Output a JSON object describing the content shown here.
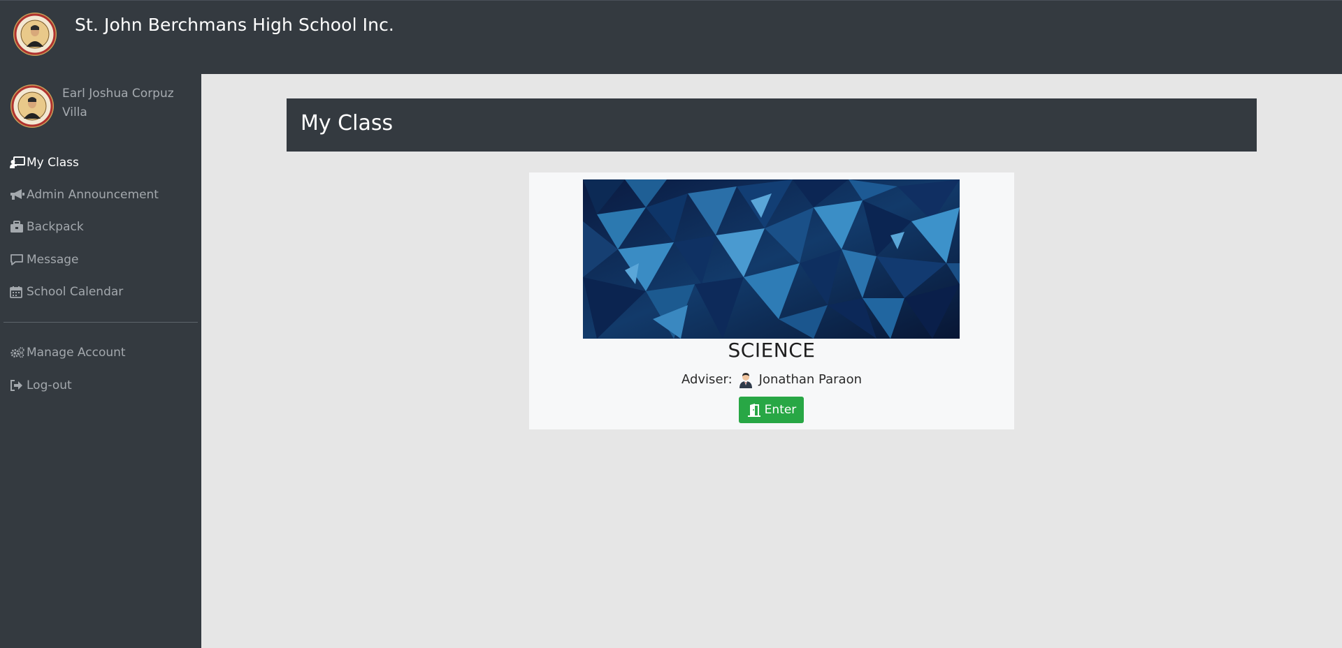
{
  "header": {
    "school_name": "St. John Berchmans High School Inc.",
    "logo_icon": "school-seal-icon"
  },
  "sidebar": {
    "user_name": "Earl Joshua Corpuz Villa",
    "nav": [
      {
        "label": "My Class",
        "icon": "chalkboard-teacher-icon",
        "active": true
      },
      {
        "label": "Admin Announcement",
        "icon": "bullhorn-icon",
        "active": false
      },
      {
        "label": "Backpack",
        "icon": "briefcase-icon",
        "active": false
      },
      {
        "label": "Message",
        "icon": "comment-icon",
        "active": false
      },
      {
        "label": "School Calendar",
        "icon": "calendar-icon",
        "active": false
      }
    ],
    "account_nav": [
      {
        "label": "Manage Account",
        "icon": "cogs-icon"
      },
      {
        "label": "Log-out",
        "icon": "sign-out-icon"
      }
    ]
  },
  "main": {
    "title": "My Class",
    "class_card": {
      "subject": "SCIENCE",
      "adviser_label": "Adviser:",
      "adviser_name": "Jonathan Paraon",
      "enter_label": "Enter"
    }
  },
  "colors": {
    "dark": "#343a40",
    "content_bg": "#e6e6e6",
    "card_bg": "#f7f8f9",
    "success": "#28a745",
    "nav_text": "#a3a8ad",
    "active_text": "#ffffff"
  }
}
